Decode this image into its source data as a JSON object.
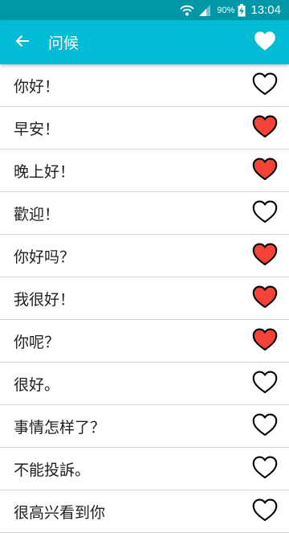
{
  "status_bar": {
    "battery_percent": "90%",
    "time": "13:04",
    "icons": [
      "wifi-icon",
      "signal-icon",
      "battery-charging-icon"
    ]
  },
  "header": {
    "title": "问候",
    "back_icon": "arrow-back-icon",
    "favorite_icon": "heart-filled-icon"
  },
  "colors": {
    "status_bar": "#0097a7",
    "app_bar": "#00bcd4",
    "heart_active": "#f44336",
    "divider": "#d6d6d6"
  },
  "phrases": [
    {
      "text": "你好！",
      "favorite": false
    },
    {
      "text": "早安！",
      "favorite": true
    },
    {
      "text": "晚上好！",
      "favorite": true
    },
    {
      "text": "歡迎！",
      "favorite": false
    },
    {
      "text": "你好吗？",
      "favorite": true
    },
    {
      "text": "我很好！",
      "favorite": true
    },
    {
      "text": "你呢？",
      "favorite": true
    },
    {
      "text": "很好。",
      "favorite": false
    },
    {
      "text": "事情怎样了？",
      "favorite": false
    },
    {
      "text": "不能投訴。",
      "favorite": false
    },
    {
      "text": "很高兴看到你",
      "favorite": false
    }
  ]
}
